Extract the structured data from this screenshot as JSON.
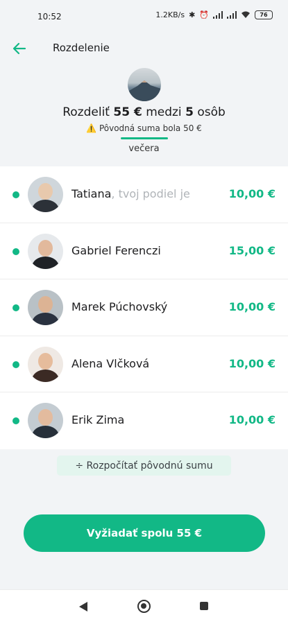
{
  "status": {
    "time": "10:52",
    "network_speed": "1.2KB/s",
    "battery": "76"
  },
  "appbar": {
    "title": "Rozdelenie"
  },
  "header": {
    "summary_prefix": "Rozdeliť",
    "summary_amount": "55 €",
    "summary_middle": "medzi",
    "summary_count": "5",
    "summary_suffix": "osôb",
    "warning_icon": "⚠️",
    "warning_text": "Pôvodná suma bola 50 €",
    "tab_label": "večera"
  },
  "people": [
    {
      "name": "Tatiana",
      "hint": ", tvoj podiel je",
      "amount": "10,00 €"
    },
    {
      "name": "Gabriel Ferenczi",
      "hint": "",
      "amount": "15,00 €"
    },
    {
      "name": "Marek Púchovský",
      "hint": "",
      "amount": "10,00 €"
    },
    {
      "name": "Alena Vlčková",
      "hint": "",
      "amount": "10,00 €"
    },
    {
      "name": "Erik Zima",
      "hint": "",
      "amount": "10,00 €"
    }
  ],
  "recalc_label": "÷ Rozpočítať pôvodnú sumu",
  "cta_label": "Vyžiadať spolu 55 €",
  "colors": {
    "accent": "#12b886",
    "background": "#f2f4f6",
    "recalc_bg": "#e3f5ee"
  }
}
